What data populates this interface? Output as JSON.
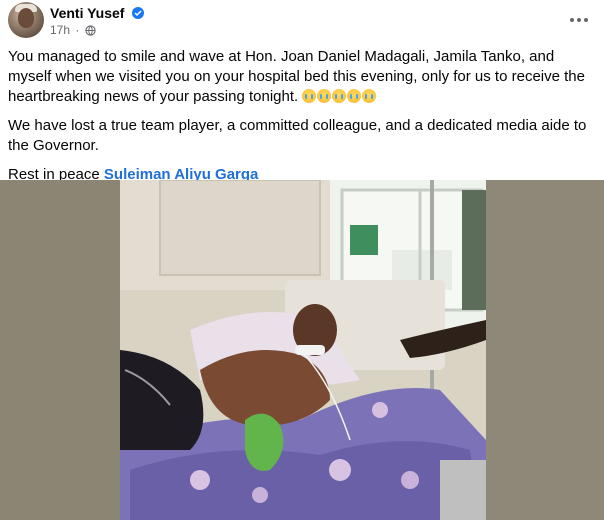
{
  "post": {
    "author_name": "Venti Yusef",
    "time": "17h",
    "dot": "·",
    "privacy_icon": "globe-icon",
    "verified_icon": "verified-badge-icon",
    "more_icon": "more-options-icon",
    "paragraphs": [
      "You managed to smile and wave at Hon. Joan Daniel Madagali, Jamila Tanko, and myself when we visited you on your hospital bed this evening, only for us to receive the heartbreaking news of your passing tonight.",
      "We have lost a true team player, a committed colleague, and a dedicated media aide to the Governor."
    ],
    "emoji_name": "loudly-crying-face",
    "emoji_count": 5,
    "closing_prefix": "Rest in peace",
    "mention": "Suleiman Aliyu Garga",
    "photo_icon": "hospital-bed-photo"
  },
  "colors": {
    "text": "#050505",
    "secondary_text": "#65676b",
    "link": "#216fdb",
    "verified": "#1877f2"
  }
}
